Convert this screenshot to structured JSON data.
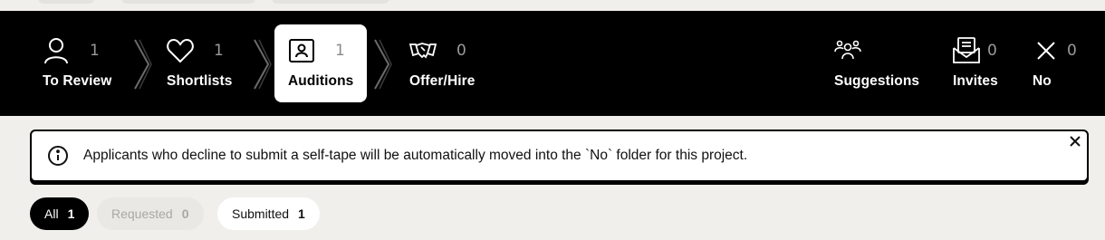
{
  "pipeline": {
    "stages": [
      {
        "label": "To Review",
        "count": "1",
        "icon": "person-icon"
      },
      {
        "label": "Shortlists",
        "count": "1",
        "icon": "heart-icon"
      },
      {
        "label": "Auditions",
        "count": "1",
        "icon": "id-card-icon",
        "active": true
      },
      {
        "label": "Offer/Hire",
        "count": "0",
        "icon": "handshake-icon"
      }
    ],
    "right_items": [
      {
        "label": "Suggestions",
        "count": "",
        "icon": "group-icon"
      },
      {
        "label": "Invites",
        "count": "0",
        "icon": "envelope-icon"
      },
      {
        "label": "No",
        "count": "0",
        "icon": "x-icon"
      }
    ]
  },
  "alert": {
    "message": "Applicants who decline to submit a self-tape will be automatically moved into the `No` folder for this project."
  },
  "filters": [
    {
      "label": "All",
      "count": "1",
      "state": "selected"
    },
    {
      "label": "Requested",
      "count": "0",
      "state": "disabled"
    },
    {
      "label": "Submitted",
      "count": "1",
      "state": "normal"
    }
  ],
  "colors": {
    "background": "#f0efeb",
    "header": "#000000",
    "active_tab": "#ffffff",
    "muted_count": "#9a9a9a"
  }
}
